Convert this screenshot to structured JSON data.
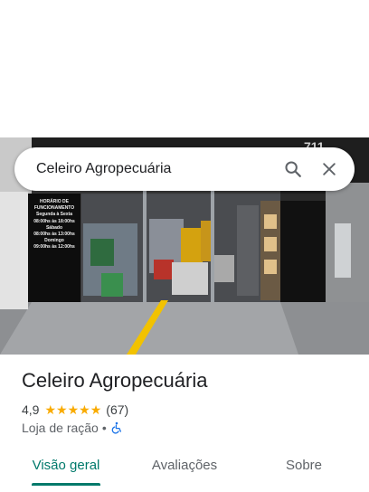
{
  "search": {
    "query": "Celeiro Agropecuária"
  },
  "photo": {
    "sign_lines": [
      "HORÁRIO DE",
      "FUNCIONAMENTO",
      "Segunda à Sexta",
      "08:00hs às 18:00hs",
      "Sábado",
      "08:00hs às 13:00hs",
      "Domingo",
      "09:00hs às 12:00hs"
    ],
    "building_number": "711"
  },
  "place": {
    "name": "Celeiro Agropecuária",
    "rating": "4,9",
    "rating_value": 4.9,
    "stars_filled": 5,
    "review_count": "(67)",
    "category": "Loja de ração",
    "separator": "•"
  },
  "tabs": [
    {
      "label": "Visão geral",
      "active": true
    },
    {
      "label": "Avaliações",
      "active": false
    },
    {
      "label": "Sobre",
      "active": false
    }
  ],
  "colors": {
    "accent": "#00796b",
    "star": "#f9ab00",
    "accessibility": "#1a73e8"
  },
  "icons": {
    "search": "search-icon",
    "close": "close-icon",
    "accessibility": "wheelchair-icon"
  }
}
